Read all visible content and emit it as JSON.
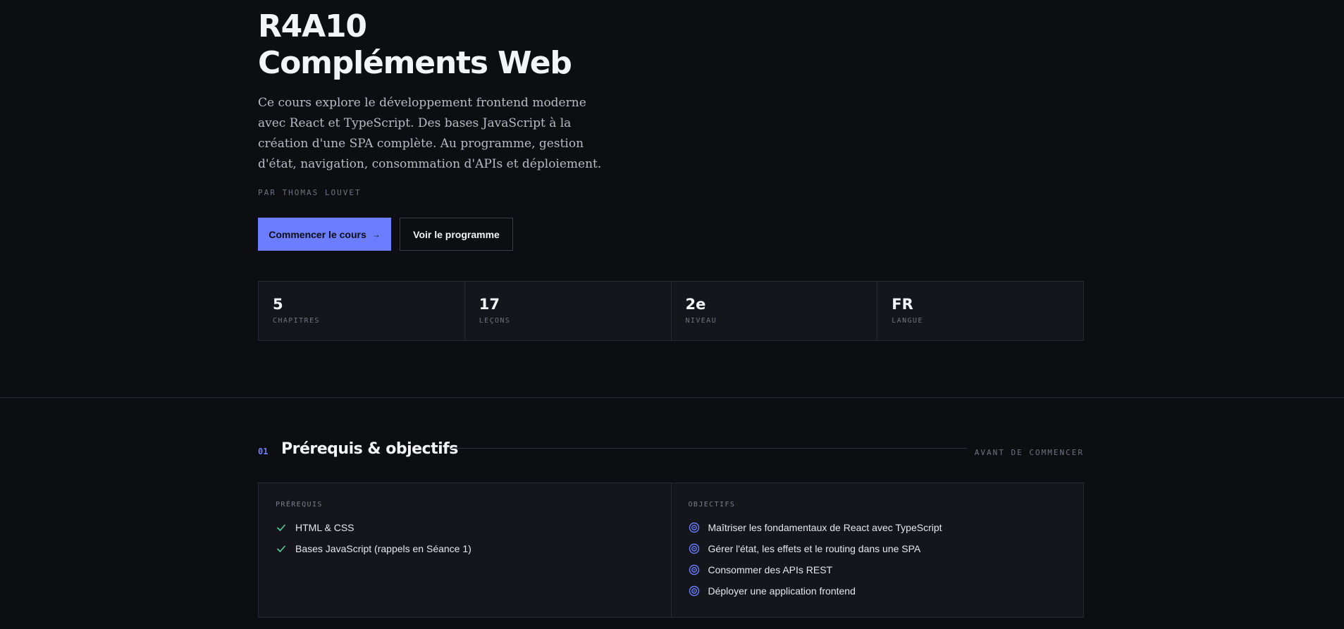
{
  "hero": {
    "title_line1": "R4A10",
    "title_line2": "Compléments Web",
    "description": "Ce cours explore le développement frontend moderne avec React et TypeScript. Des bases JavaScript à la création d'une SPA complète. Au programme, gestion d'état, navigation, consommation d'APIs et déploiement.",
    "author": "PAR THOMAS LOUVET",
    "primary_button": "Commencer le cours",
    "primary_button_icon": "arrow-right-icon",
    "secondary_button": "Voir le programme"
  },
  "stats": [
    {
      "value": "5",
      "label": "CHAPITRES"
    },
    {
      "value": "17",
      "label": "LEÇONS"
    },
    {
      "value": "2e",
      "label": "NIVEAU"
    },
    {
      "value": "FR",
      "label": "LANGUE"
    }
  ],
  "section": {
    "number": "01",
    "title": "Prérequis & objectifs",
    "tag": "AVANT DE COMMENCER"
  },
  "prerequisites": {
    "title": "PRÉREQUIS",
    "icon": "check-icon",
    "items": [
      "HTML & CSS",
      "Bases JavaScript (rappels en Séance 1)"
    ]
  },
  "objectives": {
    "title": "OBJECTIFS",
    "icon": "target-icon",
    "items": [
      "Maîtriser les fondamentaux de React avec TypeScript",
      "Gérer l'état, les effets et le routing dans une SPA",
      "Consommer des APIs REST",
      "Déployer une application frontend"
    ]
  },
  "colors": {
    "background": "#0d0e12",
    "surface": "#14161c",
    "accent": "#6c7dff",
    "check": "#4fd1a0",
    "muted": "#6f7381"
  }
}
